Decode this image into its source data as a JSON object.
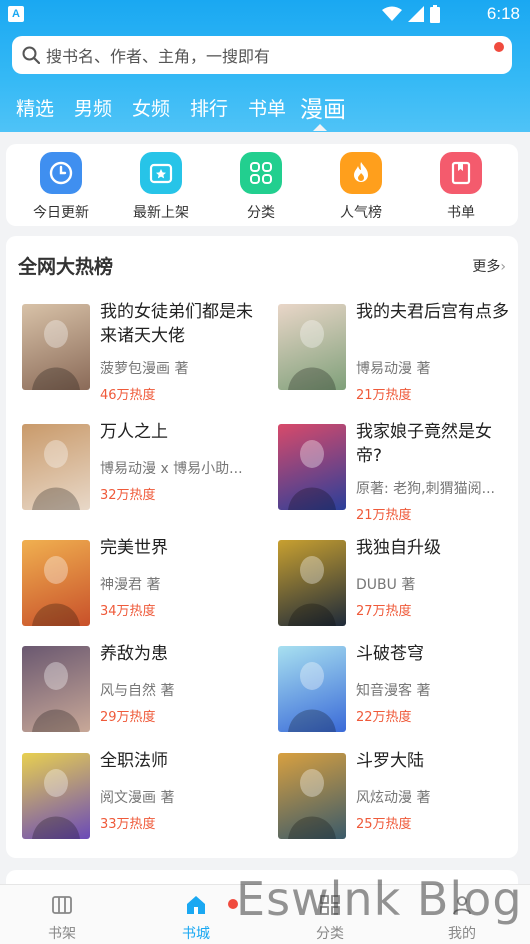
{
  "status_bar": {
    "time": "6:18",
    "app_badge": "A"
  },
  "search": {
    "placeholder": "搜书名、作者、主角，一搜即有"
  },
  "tabs": [
    {
      "label": "精选",
      "active": false
    },
    {
      "label": "男频",
      "active": false
    },
    {
      "label": "女频",
      "active": false
    },
    {
      "label": "排行",
      "active": false
    },
    {
      "label": "书单",
      "active": false
    },
    {
      "label": "漫画",
      "active": true
    }
  ],
  "quick_links": [
    {
      "label": "今日更新",
      "icon": "clock-icon",
      "color": "#3f8ff0"
    },
    {
      "label": "最新上架",
      "icon": "star-box-icon",
      "color": "#27c4e8"
    },
    {
      "label": "分类",
      "icon": "grid-icon",
      "color": "#22cf8f"
    },
    {
      "label": "人气榜",
      "icon": "flame-icon",
      "color": "#ff9f1c"
    },
    {
      "label": "书单",
      "icon": "bookmark-book-icon",
      "color": "#f45b6d"
    }
  ],
  "hot_list": {
    "title": "全网大热榜",
    "more": "更多",
    "books": [
      {
        "title": "我的女徒弟们都是未来诸天大佬",
        "author": "菠萝包漫画 著",
        "heat": "46万热度",
        "cover_colors": [
          "#8a6a58",
          "#d8c2a8"
        ]
      },
      {
        "title": "我的夫君后宫有点多",
        "author": "博易动漫 著",
        "heat": "21万热度",
        "cover_colors": [
          "#7fa07a",
          "#e9d6c8"
        ]
      },
      {
        "title": "万人之上",
        "author": "博易动漫 x 博易小助...",
        "heat": "32万热度",
        "cover_colors": [
          "#e8d8c8",
          "#c99a6a"
        ]
      },
      {
        "title": "我家娘子竟然是女帝?",
        "author": "原著: 老狗,刺猬猫阅...",
        "heat": "21万热度",
        "cover_colors": [
          "#2a3f9a",
          "#d84a6a"
        ]
      },
      {
        "title": "完美世界",
        "author": "神漫君 著",
        "heat": "34万热度",
        "cover_colors": [
          "#c8502a",
          "#f0b050"
        ]
      },
      {
        "title": "我独自升级",
        "author": "DUBU 著",
        "heat": "27万热度",
        "cover_colors": [
          "#1e2a3a",
          "#c8a030"
        ]
      },
      {
        "title": "养敌为患",
        "author": "风与自然 著",
        "heat": "29万热度",
        "cover_colors": [
          "#c8a898",
          "#6a5870"
        ]
      },
      {
        "title": "斗破苍穹",
        "author": "知音漫客 著",
        "heat": "22万热度",
        "cover_colors": [
          "#3a6ad8",
          "#a8e0f0"
        ]
      },
      {
        "title": "全职法师",
        "author": "阅文漫画 著",
        "heat": "33万热度",
        "cover_colors": [
          "#6a4ab8",
          "#e8d050"
        ]
      },
      {
        "title": "斗罗大陆",
        "author": "风炫动漫 著",
        "heat": "25万热度",
        "cover_colors": [
          "#3a5a6a",
          "#d8a040"
        ]
      }
    ]
  },
  "bottom_nav": [
    {
      "label": "书架",
      "icon": "bookshelf-icon",
      "active": false
    },
    {
      "label": "书城",
      "icon": "home-icon",
      "active": true
    },
    {
      "label": "分类",
      "icon": "category-icon",
      "active": false
    },
    {
      "label": "我的",
      "icon": "profile-icon",
      "active": false
    }
  ],
  "watermark": "Eswlnk Blog",
  "colors": {
    "header": "#1aa8f2",
    "accent": "#1aa8f2",
    "heat": "#ef5a3a",
    "badge": "#f04b3e"
  }
}
